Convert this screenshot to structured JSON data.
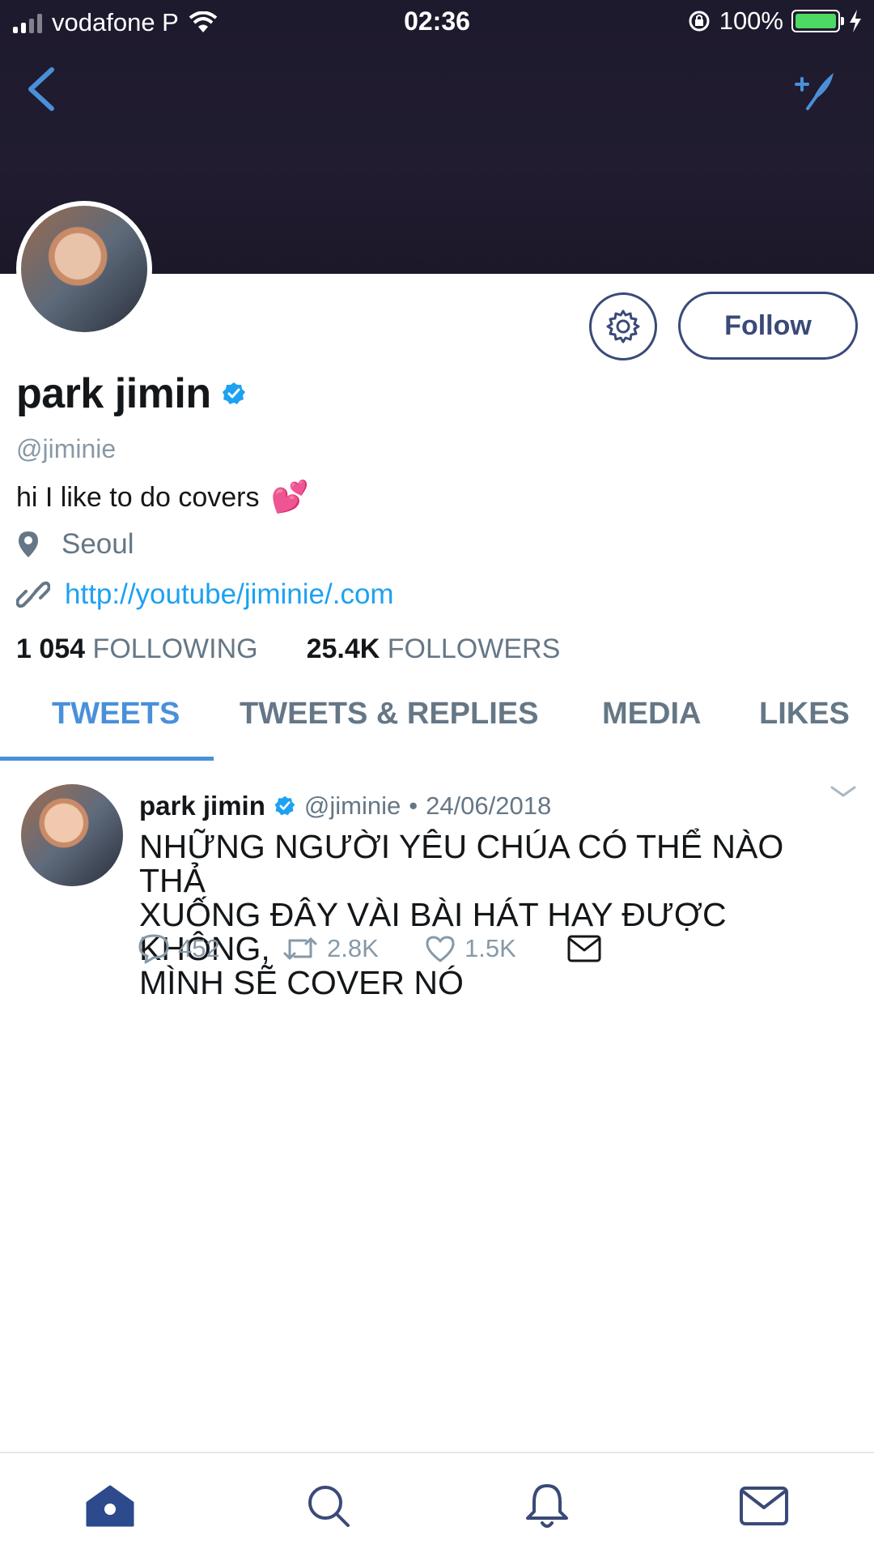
{
  "status_bar": {
    "carrier": "vodafone P",
    "time": "02:36",
    "battery": "100%"
  },
  "profile": {
    "name": "park jimin",
    "handle": "@jiminie",
    "bio": "hi I like to do covers",
    "bio_emoji": "💕",
    "location": "Seoul",
    "website": "http://youtube/jiminie/.com",
    "following_count": "1 054",
    "following_label": "FOLLOWING",
    "followers_count": "25.4K",
    "followers_label": "FOLLOWERS",
    "follow_button": "Follow"
  },
  "tabs": [
    {
      "label": "TWEETS",
      "active": true
    },
    {
      "label": "TWEETS & REPLIES",
      "active": false
    },
    {
      "label": "MEDIA",
      "active": false
    },
    {
      "label": "LIKES",
      "active": false
    }
  ],
  "tweet": {
    "name": "park jimin",
    "handle": "@jiminie",
    "separator": "•",
    "date": "24/06/2018",
    "text_lines": [
      "NHỮNG NGƯỜI YÊU CHÚA CÓ THỂ NÀO THẢ",
      "XUỐNG ĐÂY VÀI BÀI HÁT HAY ĐƯỢC KHÔNG,",
      "MÌNH SẼ COVER NÓ"
    ],
    "replies": "452",
    "retweets": "2.8K",
    "likes": "1.5K"
  },
  "colors": {
    "accent": "#4a90d9",
    "banner": "#1f1b2e",
    "button_border": "#3a4a78",
    "verified": "#1da1f2"
  },
  "icons": {
    "back": "back-chevron-icon",
    "compose": "compose-quill-icon",
    "settings": "gear-icon",
    "verified": "verified-badge-icon",
    "location": "map-pin-icon",
    "link": "link-icon",
    "reply": "reply-bubble-icon",
    "retweet": "retweet-icon",
    "like": "heart-icon",
    "dm": "envelope-icon",
    "nav": [
      "home-icon",
      "search-icon",
      "bell-icon",
      "mail-icon"
    ]
  }
}
